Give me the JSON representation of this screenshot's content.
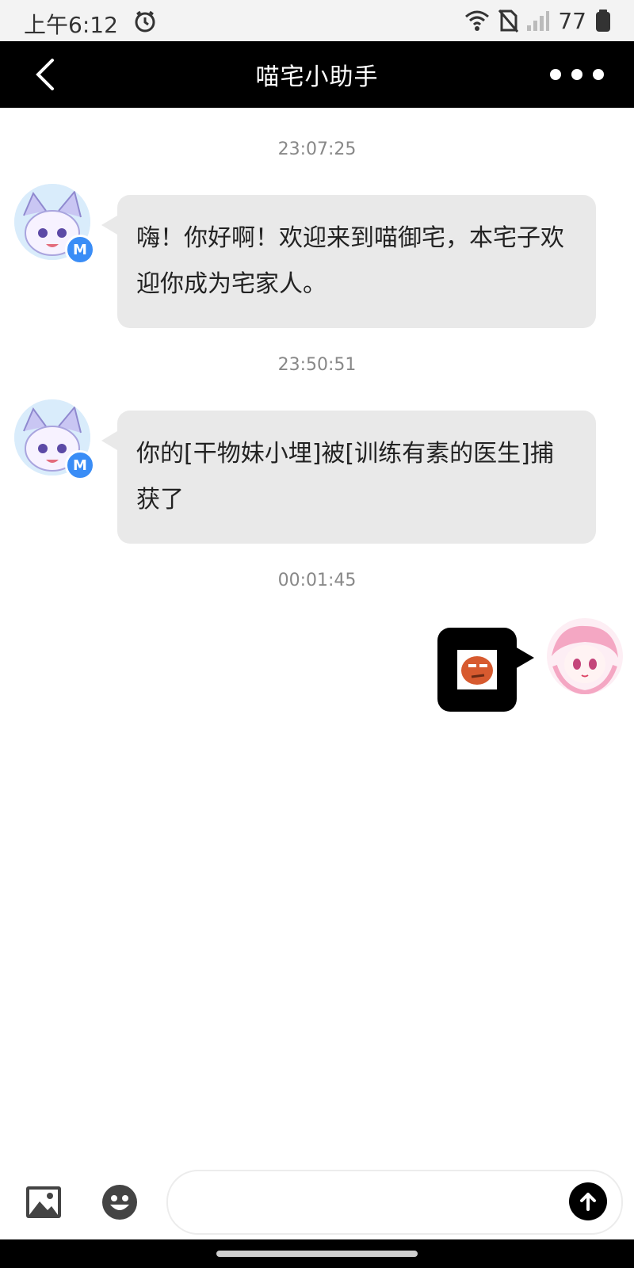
{
  "status_bar": {
    "time": "上午6:12",
    "battery": "77"
  },
  "header": {
    "title": "喵宅小助手"
  },
  "messages": [
    {
      "timestamp": "23:07:25",
      "text": "嗨！你好啊！欢迎来到喵御宅，本宅子欢迎你成为宅家人。"
    },
    {
      "timestamp": "23:50:51",
      "text": "你的[干物妹小埋]被[训练有素的医生]捕获了"
    },
    {
      "timestamp": "00:01:45"
    }
  ],
  "colors": {
    "header_bg": "#000000",
    "bubble_bg": "#e9e9e9",
    "badge_bg": "#3a8df6"
  },
  "icons": [
    "back-icon",
    "more-icon",
    "image-icon",
    "emoji-icon",
    "send-icon",
    "alarm-icon",
    "wifi-icon",
    "no-sim-icon",
    "signal-icon",
    "battery-icon"
  ]
}
